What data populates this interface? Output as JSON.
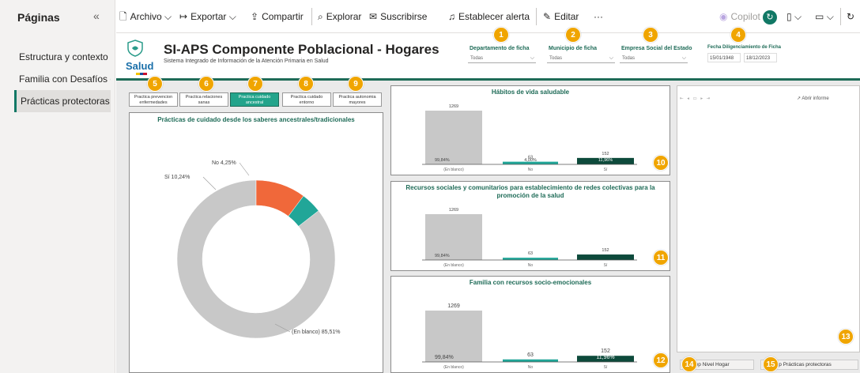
{
  "pages_pane": {
    "title": "Páginas",
    "collapse_icon": "«",
    "items": [
      {
        "label": "Estructura y contexto",
        "active": false
      },
      {
        "label": "Familia con Desafíos de ...",
        "active": false
      },
      {
        "label": "Prácticas protectoras",
        "active": true
      }
    ]
  },
  "toolbar": {
    "archivo": "Archivo",
    "exportar": "Exportar",
    "compartir": "Compartir",
    "explorar": "Explorar",
    "suscribirse": "Suscribirse",
    "establecer_alerta": "Establecer alerta",
    "editar": "Editar",
    "more": "···",
    "copilot": "Copilot"
  },
  "header": {
    "logo_text": "Salud",
    "title": "SI-APS Componente Poblacional - Hogares",
    "subtitle": "Sistema Integrado de Información de la Atención Primaria en Salud"
  },
  "filters": [
    {
      "label": "Departamento de ficha",
      "value": "Todas"
    },
    {
      "label": "Municipio de ficha",
      "value": "Todas"
    },
    {
      "label": "Empresa Social del Estado",
      "value": "Todas"
    }
  ],
  "date_filter": {
    "label": "Fecha Diligenciamiento de Ficha",
    "start": "15/01/1948",
    "end": "18/12/2023"
  },
  "tabs": [
    "Practica prevencion enfermedades",
    "Practica relaciones sanas",
    "Practica cuidado ancestral",
    "Practica cuidado entorno",
    "Practica autonomia mayores"
  ],
  "donut": {
    "title": "Prácticas de cuidado desde los saberes ancestrales/tradicionales",
    "labels": {
      "no": "No 4,25%",
      "si": "Sí 10,24%",
      "blanco": "(En blanco) 85,51%"
    }
  },
  "bar_panels": [
    {
      "title": "Hábitos de vida saludable",
      "category_labels": [
        "(En blanco)",
        "No",
        "Sí"
      ],
      "value_labels": [
        "1269",
        "63",
        "152"
      ],
      "pct_labels": [
        "99,84%",
        "4,00%",
        "11,96%"
      ]
    },
    {
      "title": "Recursos sociales y comunitarios para establecimiento de redes colectivas para la promoción de la salud",
      "category_labels": [
        "(En blanco)",
        "No",
        "Sí"
      ],
      "value_labels": [
        "1269",
        "63",
        "152"
      ],
      "pct_labels": [
        "99,84%",
        "",
        ""
      ]
    },
    {
      "title": "Familia con recursos socio-emocionales",
      "category_labels": [
        "(En blanco)",
        "No",
        "Sí"
      ],
      "value_labels": [
        "1269",
        "63",
        "152"
      ],
      "pct_labels": [
        "99,84%",
        "",
        "11,96%"
      ]
    }
  ],
  "right_panel": {
    "open_report": "Abrir informe",
    "rep_nivel_hogar": "Rep Nivel Hogar",
    "rep_practicas": "Rep Prácticas protectoras"
  },
  "badges": [
    "1",
    "2",
    "3",
    "4",
    "5",
    "6",
    "7",
    "8",
    "9",
    "10",
    "11",
    "12",
    "13",
    "14",
    "15"
  ],
  "chart_data": [
    {
      "type": "pie",
      "title": "Prácticas de cuidado desde los saberes ancestrales/tradicionales",
      "categories": [
        "(En blanco)",
        "Sí",
        "No"
      ],
      "values": [
        85.51,
        10.24,
        4.25
      ],
      "colors": [
        "#c8c8c8",
        "#f0683a",
        "#21a698"
      ]
    },
    {
      "type": "bar",
      "title": "Hábitos de vida saludable",
      "categories": [
        "(En blanco)",
        "No",
        "Sí"
      ],
      "values": [
        1269,
        63,
        152
      ]
    },
    {
      "type": "bar",
      "title": "Recursos sociales y comunitarios para establecimiento de redes colectivas para la promoción de la salud",
      "categories": [
        "(En blanco)",
        "No",
        "Sí"
      ],
      "values": [
        1269,
        63,
        152
      ]
    },
    {
      "type": "bar",
      "title": "Familia con recursos socio-emocionales",
      "categories": [
        "(En blanco)",
        "No",
        "Sí"
      ],
      "values": [
        1269,
        63,
        152
      ]
    }
  ],
  "colors": {
    "accent": "#1e6b57",
    "teal": "#21a698",
    "orange": "#f0683a",
    "grey": "#c8c8c8",
    "dark_green": "#0d4a3b",
    "badge": "#f0a500"
  }
}
